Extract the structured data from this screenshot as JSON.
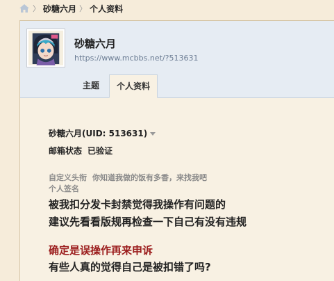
{
  "breadcrumb": {
    "home_icon": "home-icon",
    "separator": "〉",
    "items": [
      "砂糖六月",
      "个人资料"
    ]
  },
  "profile": {
    "username": "砂糖六月",
    "space_url": "https://www.mcbbs.net/?513631",
    "avatar_icon": "anime-avatar"
  },
  "tabs": [
    {
      "label": "主题",
      "active": false
    },
    {
      "label": "个人资料",
      "active": true
    }
  ],
  "details": {
    "uid_line": "砂糖六月(UID: 513631)",
    "email_label": "邮箱状态",
    "email_value": "已验证",
    "title_label": "自定义头衔",
    "title_value": "你知道我做的饭有多香，来找我吧",
    "signature_label": "个人签名",
    "signature_lines": [
      "被我扣分发卡封禁觉得我操作有问题的",
      "建议先看看版规再检查一下自己有没有违规",
      "确定是误操作再来申诉",
      "有些人真的觉得自己是被扣错了吗?"
    ]
  },
  "colors": {
    "page_bg": "#f6ecda",
    "header_bg": "#e6ecf3",
    "highlight_red": "#9b1c1c"
  }
}
